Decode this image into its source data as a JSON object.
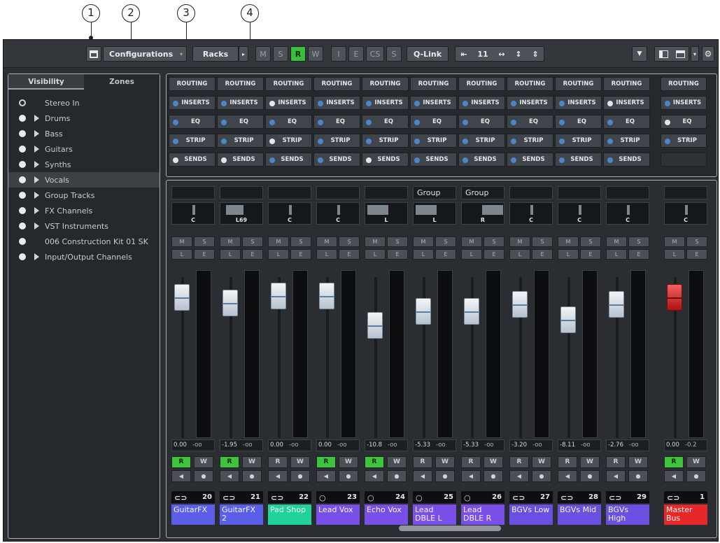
{
  "callouts": [
    "1",
    "2",
    "3",
    "4"
  ],
  "toolbar": {
    "configurations": "Configurations",
    "racks": "Racks",
    "m": "M",
    "s": "S",
    "r": "R",
    "w": "W",
    "i": "I",
    "e": "E",
    "cs": "CS",
    "s2": "S",
    "qlink": "Q-Link",
    "zoom": "11"
  },
  "left_zone": {
    "tab_visibility": "Visibility",
    "tab_zones": "Zones",
    "items": [
      {
        "label": "Stereo In",
        "folder": false,
        "hollow": true
      },
      {
        "label": "Drums",
        "folder": true
      },
      {
        "label": "Bass",
        "folder": true
      },
      {
        "label": "Guitars",
        "folder": true
      },
      {
        "label": "Synths",
        "folder": true
      },
      {
        "label": "Vocals",
        "folder": true,
        "selected": true
      },
      {
        "label": "Group Tracks",
        "folder": true
      },
      {
        "label": "FX Channels",
        "folder": true
      },
      {
        "label": "VST Instruments",
        "folder": true
      },
      {
        "label": "006 Construction Kit 01 SK",
        "folder": false
      },
      {
        "label": "Input/Output Channels",
        "folder": true
      }
    ]
  },
  "racks": {
    "routing": "ROUTING",
    "inserts": "INSERTS",
    "eq": "EQ",
    "strip": "STRIP",
    "sends": "SENDS"
  },
  "channels": [
    {
      "group": "",
      "pan": "C",
      "gain": "0.00",
      "peak": "-oo",
      "r_on": true,
      "number": "20",
      "name": "GuitarFX",
      "color": "#5a5ee8"
    },
    {
      "group": "",
      "pan": "L69",
      "gain": "-1.95",
      "peak": "-oo",
      "r_on": true,
      "number": "21",
      "name": "GuitarFX 2",
      "color": "#5a5ee8"
    },
    {
      "group": "",
      "pan": "C",
      "gain": "0.00",
      "peak": "-oo",
      "r_on": false,
      "number": "22",
      "name": "Pad Shop",
      "color": "#1fd39a"
    },
    {
      "group": "",
      "pan": "C",
      "gain": "0.00",
      "peak": "-oo",
      "r_on": true,
      "number": "23",
      "name": "Lead Vox",
      "color": "#7a4fe8"
    },
    {
      "group": "",
      "pan": "L",
      "gain": "-10.8",
      "peak": "-oo",
      "r_on": true,
      "number": "24",
      "name": "Echo Vox",
      "color": "#7a4fe8"
    },
    {
      "group": "Group",
      "pan": "L",
      "gain": "-5.33",
      "peak": "-oo",
      "r_on": false,
      "number": "25",
      "name": "Lead DBLE L",
      "color": "#7a4fe8"
    },
    {
      "group": "Group",
      "pan": "R",
      "gain": "-5.33",
      "peak": "-oo",
      "r_on": false,
      "number": "26",
      "name": "Lead DBLE R",
      "color": "#7a4fe8"
    },
    {
      "group": "",
      "pan": "C",
      "gain": "-3.20",
      "peak": "-oo",
      "r_on": false,
      "number": "27",
      "name": "BGVs Low",
      "color": "#6a4fe0"
    },
    {
      "group": "",
      "pan": "C",
      "gain": "-8.11",
      "peak": "-oo",
      "r_on": false,
      "number": "28",
      "name": "BGVs Mid",
      "color": "#6a4fe0"
    },
    {
      "group": "",
      "pan": "C",
      "gain": "-2.76",
      "peak": "-oo",
      "r_on": false,
      "number": "29",
      "name": "BGVs High",
      "color": "#6a4fe0"
    },
    {
      "group": "",
      "pan": "C",
      "gain": "0.00",
      "peak": "-0.2",
      "r_on": true,
      "number": "1",
      "name": "Master Bus",
      "color": "#e82828",
      "master": true
    }
  ],
  "button_labels": {
    "m": "M",
    "s": "S",
    "listen": "L",
    "edit": "E",
    "r": "R",
    "w": "W"
  }
}
